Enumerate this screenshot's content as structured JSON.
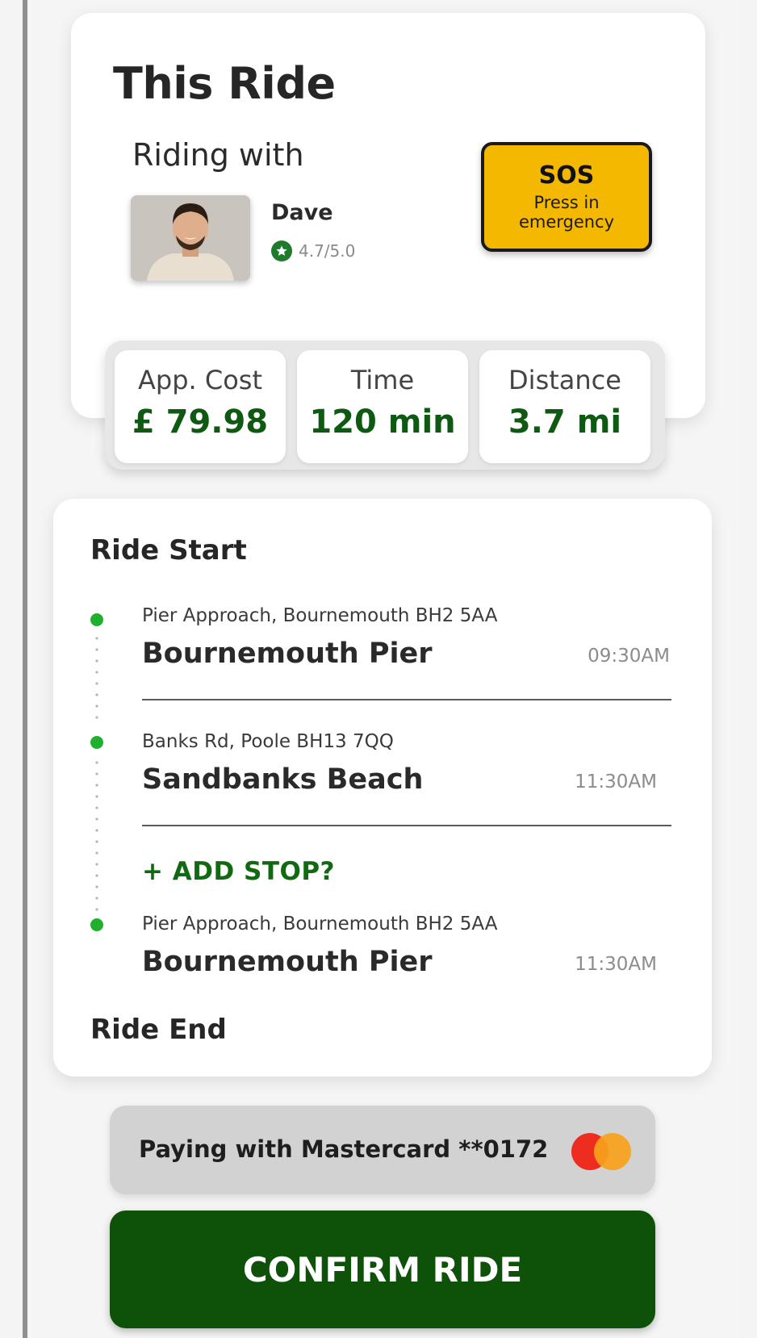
{
  "ride": {
    "title": "This Ride",
    "riding_with_label": "Riding with",
    "driver_name": "Dave",
    "driver_rating": "4.7/5.0"
  },
  "sos": {
    "title": "SOS",
    "subtitle": "Press in emergency"
  },
  "stats": [
    {
      "label": "App. Cost",
      "value": "£ 79.98"
    },
    {
      "label": "Time",
      "value": "120 min"
    },
    {
      "label": "Distance",
      "value": "3.7 mi"
    }
  ],
  "route": {
    "start_label": "Ride Start",
    "end_label": "Ride End",
    "add_stop_label": "+ ADD STOP?",
    "stops": [
      {
        "address": "Pier Approach, Bournemouth BH2 5AA",
        "name": "Bournemouth Pier",
        "time": "09:30AM"
      },
      {
        "address": "Banks Rd, Poole BH13 7QQ",
        "name": "Sandbanks Beach",
        "time": "11:30AM"
      },
      {
        "address": "Pier Approach, Bournemouth BH2 5AA",
        "name": "Bournemouth Pier",
        "time": "11:30AM"
      }
    ]
  },
  "payment": {
    "label": "Paying with Mastercard **0172",
    "icon": "mastercard-icon"
  },
  "confirm_label": "CONFIRM RIDE",
  "colors": {
    "accent_green": "#0e5a12",
    "sos_yellow": "#f5b800",
    "dot_green": "#1fb12e",
    "confirm_green": "#0d5208"
  }
}
